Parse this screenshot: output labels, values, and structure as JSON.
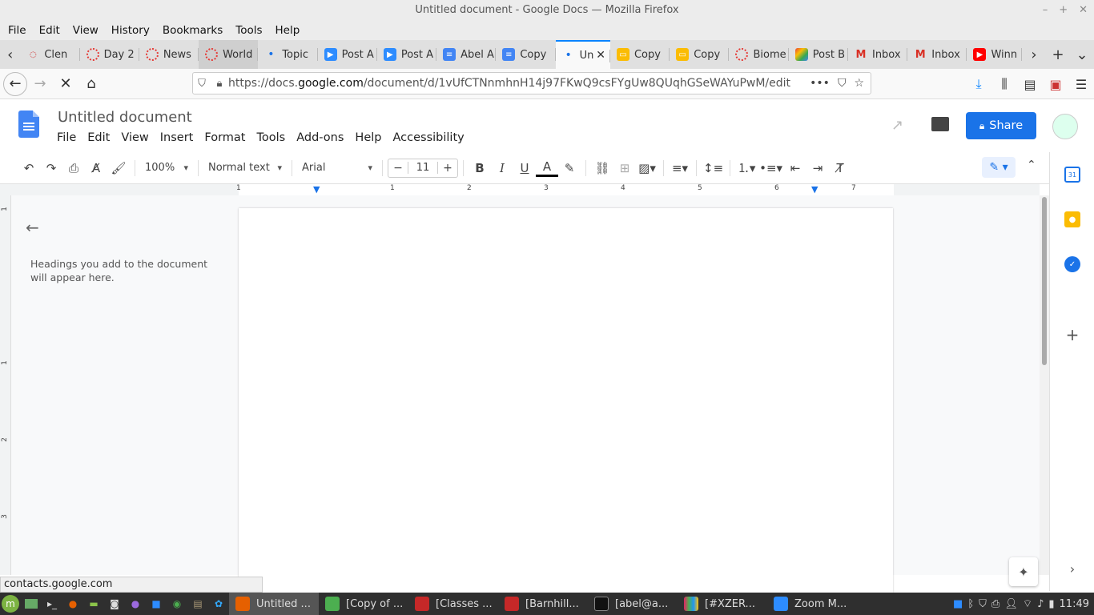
{
  "window": {
    "title": "Untitled document - Google Docs — Mozilla Firefox"
  },
  "menubar": [
    "File",
    "Edit",
    "View",
    "History",
    "Bookmarks",
    "Tools",
    "Help"
  ],
  "tabs": [
    {
      "title": "Clen",
      "icon": "opera-icon"
    },
    {
      "title": "Day 2",
      "icon": "circle-icon"
    },
    {
      "title": "News",
      "icon": "circle-icon"
    },
    {
      "title": "World",
      "icon": "circle-icon"
    },
    {
      "title": "Topic",
      "icon": "dot-icon"
    },
    {
      "title": "Post A",
      "icon": "zoom-icon"
    },
    {
      "title": "Post A",
      "icon": "zoom-icon"
    },
    {
      "title": "Abel A",
      "icon": "docs-icon"
    },
    {
      "title": "Copy",
      "icon": "docs-icon"
    },
    {
      "title": "Un",
      "icon": "loading-icon"
    },
    {
      "title": "Copy",
      "icon": "slides-icon"
    },
    {
      "title": "Copy",
      "icon": "slides-icon"
    },
    {
      "title": "Biome",
      "icon": "circle-icon"
    },
    {
      "title": "Post B",
      "icon": "photos-icon"
    },
    {
      "title": "Inbox",
      "icon": "gmail-icon"
    },
    {
      "title": "Inbox",
      "icon": "gmail-icon"
    },
    {
      "title": "Winn",
      "icon": "youtube-icon"
    }
  ],
  "url": {
    "prefix": "https://docs.",
    "domain": "google.com",
    "path": "/document/d/1vUfCTNnmhnH14j97FKwQ9csFYgUw8QUqhGSeWAYuPwM/edit"
  },
  "doc": {
    "title": "Untitled document",
    "menu": [
      "File",
      "Edit",
      "View",
      "Insert",
      "Format",
      "Tools",
      "Add-ons",
      "Help",
      "Accessibility"
    ],
    "share_label": "Share"
  },
  "toolbar": {
    "zoom": "100%",
    "style": "Normal text",
    "font": "Arial",
    "size": "11"
  },
  "ruler": [
    "1",
    "1",
    "2",
    "3",
    "4",
    "5",
    "6",
    "7"
  ],
  "left_ruler": [
    "1",
    "1",
    "2",
    "3"
  ],
  "outline": {
    "empty_text": "Headings you add to the document will appear here."
  },
  "status_url": "contacts.google.com",
  "taskbar": {
    "windows": [
      {
        "label": "Untitled ...",
        "color": "#e66000"
      },
      {
        "label": "[Copy of ...",
        "color": "#4caf50"
      },
      {
        "label": "[Classes ...",
        "color": "#c62828"
      },
      {
        "label": "[Barnhill...",
        "color": "#c62828"
      },
      {
        "label": "[abel@a...",
        "color": "#333333"
      },
      {
        "label": "[#XZER...",
        "color": "#e91e63"
      },
      {
        "label": "Zoom M...",
        "color": "#2d8cff"
      }
    ],
    "clock": "11:49"
  },
  "colors": {
    "accent": "#1a73e8",
    "tab_active": "#0a84ff"
  }
}
